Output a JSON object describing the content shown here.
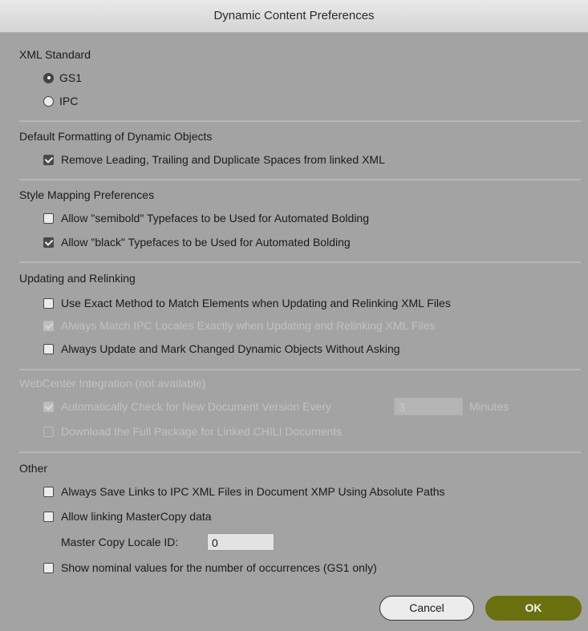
{
  "window": {
    "title": "Dynamic Content Preferences"
  },
  "xml_standard": {
    "heading": "XML Standard",
    "options": [
      {
        "label": "GS1",
        "selected": true
      },
      {
        "label": "IPC",
        "selected": false
      }
    ]
  },
  "default_formatting": {
    "heading": "Default Formatting of Dynamic Objects",
    "remove_spaces": {
      "label": "Remove Leading, Trailing and Duplicate Spaces from linked XML",
      "checked": true
    }
  },
  "style_mapping": {
    "heading": "Style Mapping Preferences",
    "semibold": {
      "label": "Allow \"semibold\" Typefaces to be Used for Automated Bolding",
      "checked": false
    },
    "black": {
      "label": "Allow \"black\" Typefaces to be Used for Automated Bolding",
      "checked": true
    }
  },
  "updating": {
    "heading": "Updating and Relinking",
    "exact_method": {
      "label": "Use Exact Method to Match Elements when Updating and Relinking XML Files",
      "checked": false
    },
    "ipc_locales": {
      "label": "Always Match IPC Locales Exactly when Updating and Relinking XML Files",
      "checked": true,
      "disabled": true
    },
    "always_update": {
      "label": "Always Update and Mark Changed Dynamic Objects Without Asking",
      "checked": false
    }
  },
  "webcenter": {
    "heading": "WebCenter Integration (not available)",
    "auto_check": {
      "label": "Automatically Check for New Document Version Every",
      "checked": true,
      "disabled": true
    },
    "minutes_value": "3",
    "minutes_unit": "Minutes",
    "download_package": {
      "label": "Download the Full Package for Linked CHILI Documents",
      "checked": false,
      "disabled": true
    }
  },
  "other": {
    "heading": "Other",
    "absolute_paths": {
      "label": "Always Save Links to IPC XML Files in Document XMP Using Absolute Paths",
      "checked": false
    },
    "mastercopy": {
      "label": "Allow linking MasterCopy data",
      "checked": false
    },
    "locale_id_label": "Master Copy Locale ID:",
    "locale_id_value": "0",
    "nominal_values": {
      "label": "Show nominal values for the number of occurrences (GS1 only)",
      "checked": false
    }
  },
  "buttons": {
    "cancel": "Cancel",
    "ok": "OK"
  },
  "colors": {
    "ok_button": "#6a7010",
    "dialog_background": "#a3a3a3"
  }
}
